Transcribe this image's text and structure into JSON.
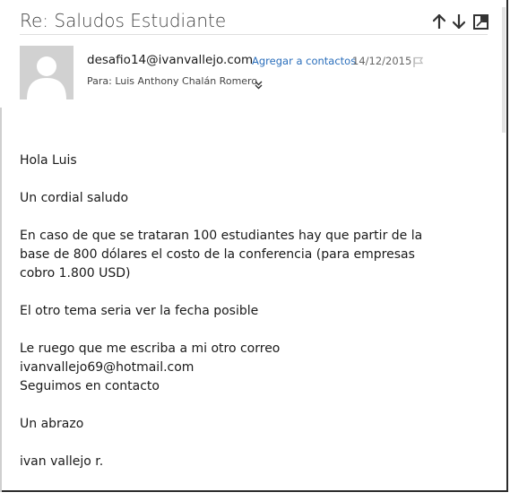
{
  "email": {
    "subject": "Re: Saludos Estudiante",
    "sender": "desafio14@ivanvallejo.com",
    "add_contact_label": "Agregar a contactos",
    "date": "14/12/2015",
    "to_line": "Para: Luis Anthony Chalán Romero",
    "icons": {
      "previous": "arrow-up-icon",
      "next": "arrow-down-icon",
      "popout": "popout-icon",
      "flag": "flag-icon",
      "expand": "chevron-double-down-icon",
      "avatar": "person-icon"
    },
    "body": [
      "Hola Luis",
      "Un cordial saludo",
      "En caso de que se trataran 100 estudiantes hay que partir de la base de 800 dólares el costo de la conferencia (para empresas cobro 1.800 USD)",
      "El otro tema seria ver la fecha posible",
      "Le ruego que me escriba a mi otro correo ivanvallejo69@hotmail.com",
      "Seguimos en contacto",
      "Un abrazo",
      "ivan vallejo r."
    ]
  },
  "colors": {
    "link": "#2a6ebb",
    "avatar_bg": "#d1d1d1",
    "text": "#1a1a1a"
  }
}
